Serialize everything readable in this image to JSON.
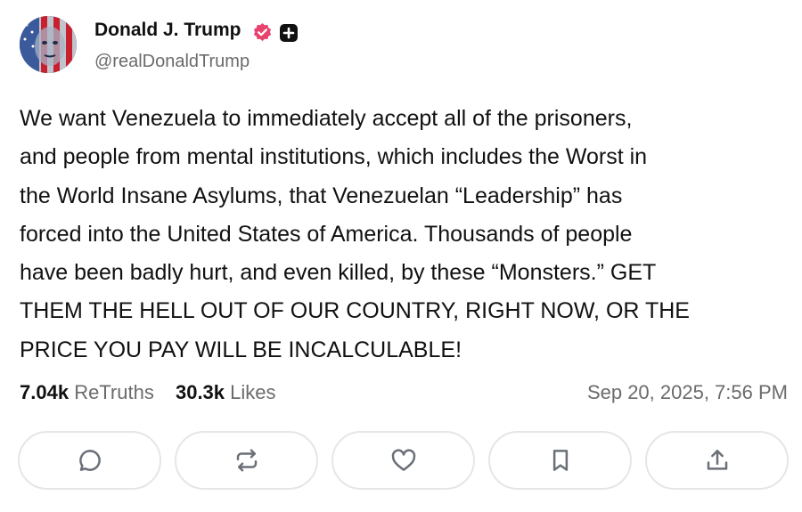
{
  "author": {
    "name": "Donald J. Trump",
    "handle": "@realDonaldTrump"
  },
  "icons": {
    "verified": "verified-badge-icon",
    "plus": "plus-badge-icon",
    "reply": "reply-icon",
    "retruth": "retruth-icon",
    "like": "heart-icon",
    "bookmark": "bookmark-icon",
    "share": "share-icon"
  },
  "colors": {
    "verified_badge": "#e8436e",
    "text": "#111111",
    "muted": "#6b6b6b",
    "button_border": "#e6e6e6"
  },
  "post": {
    "text": "We want Venezuela to immediately accept all of the prisoners,\nand people from mental institutions, which includes the Worst in\nthe World Insane Asylums, that Venezuelan “Leadership” has\nforced into the United States of America. Thousands of people\nhave been badly hurt, and even killed, by these “Monsters.” GET\nTHEM THE HELL OUT OF OUR COUNTRY, RIGHT NOW, OR THE\nPRICE YOU PAY WILL BE INCALCULABLE!"
  },
  "stats": {
    "retruths_count": "7.04k",
    "retruths_label": "ReTruths",
    "likes_count": "30.3k",
    "likes_label": "Likes"
  },
  "timestamp": "Sep 20, 2025, 7:56 PM"
}
